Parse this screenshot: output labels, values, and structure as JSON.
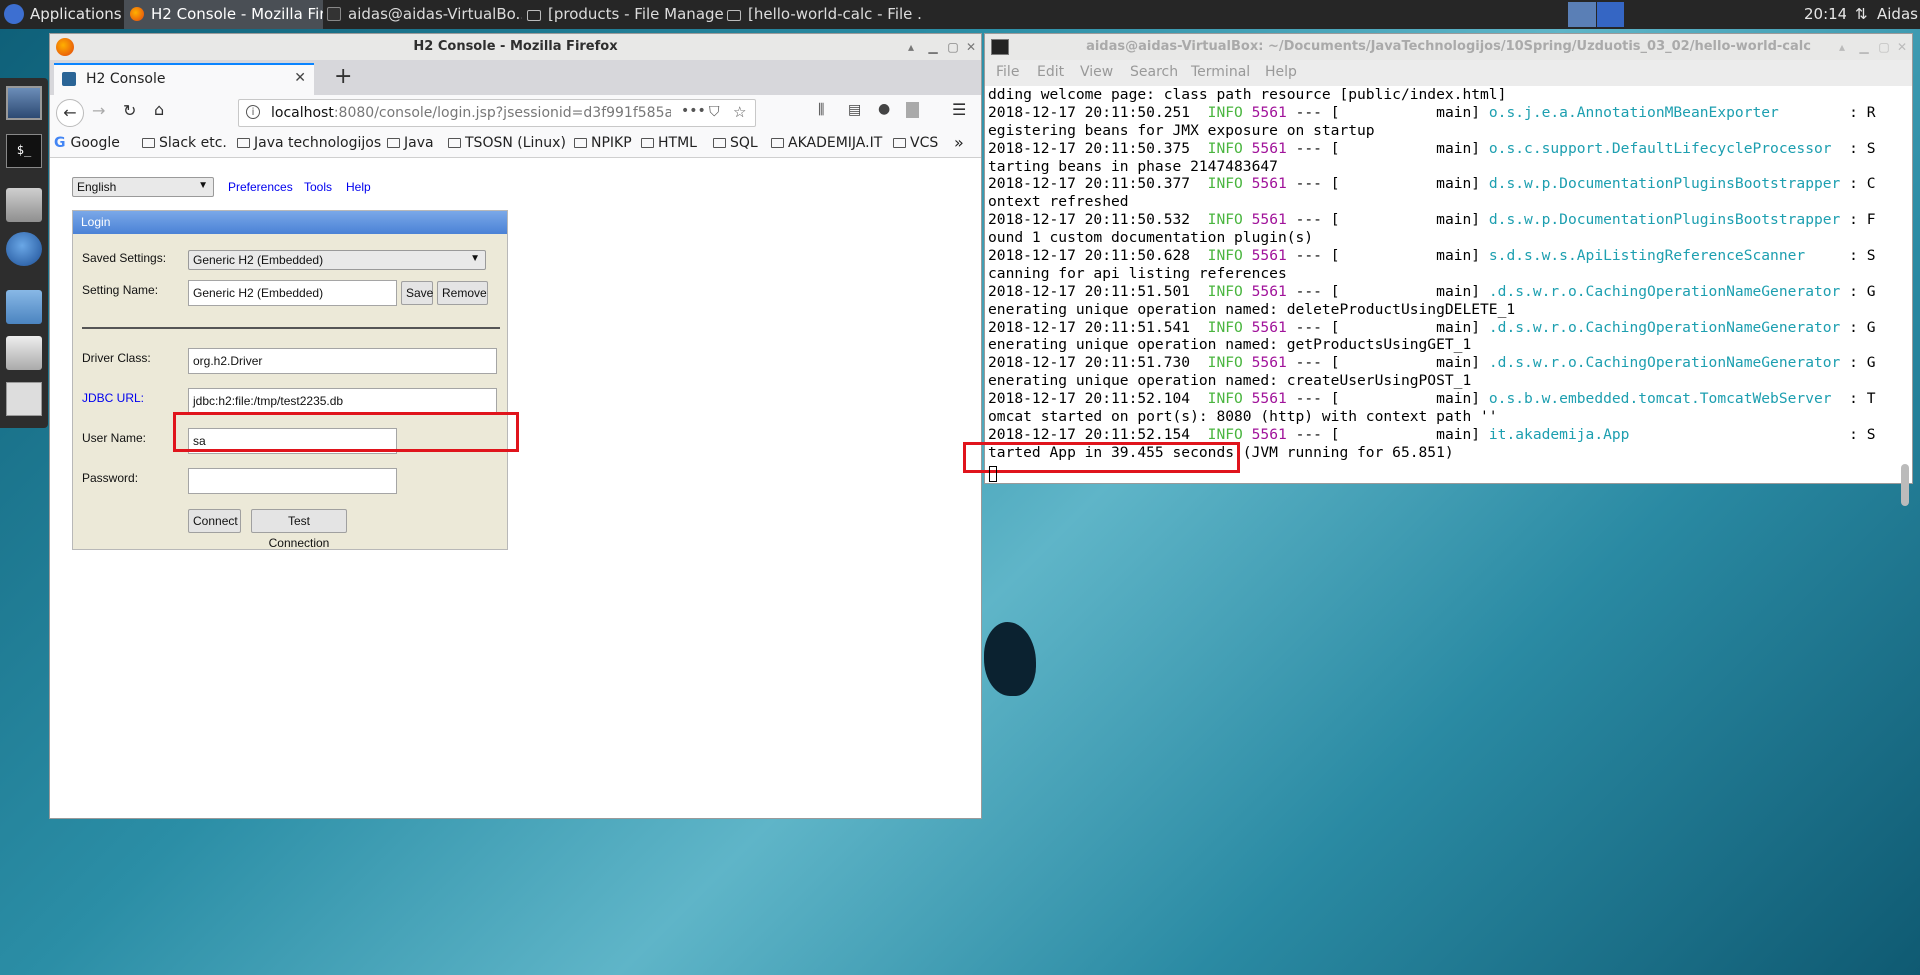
{
  "panel": {
    "applications": "Applications",
    "tasks": [
      {
        "label": "H2 Console - Mozilla Fir...",
        "active": true
      },
      {
        "label": "aidas@aidas-VirtualBo...",
        "active": false
      },
      {
        "label": "[products - File Manager]",
        "active": false
      },
      {
        "label": "[hello-world-calc - File ...",
        "active": false
      }
    ],
    "clock": "20:14",
    "user": "Aidas"
  },
  "firefox": {
    "window_title": "H2 Console - Mozilla Firefox",
    "tab_title": "H2 Console",
    "url_host": "localhost",
    "url_rest": ":8080/console/login.jsp?jsessionid=d3f991f585a",
    "bookmarks": [
      "Google",
      "Slack etc.",
      "Java technologijos",
      "Java",
      "TSOSN (Linux)",
      "NPIKP",
      "HTML",
      "SQL",
      "AKADEMIJA.IT",
      "VCS"
    ],
    "overflow": "»"
  },
  "h2": {
    "language": "English",
    "links": [
      "Preferences",
      "Tools",
      "Help"
    ],
    "login_header": "Login",
    "saved_settings_label": "Saved Settings:",
    "saved_settings_value": "Generic H2 (Embedded)",
    "setting_name_label": "Setting Name:",
    "setting_name_value": "Generic H2 (Embedded)",
    "save_button": "Save",
    "remove_button": "Remove",
    "driver_class_label": "Driver Class:",
    "driver_class_value": "org.h2.Driver",
    "jdbc_url_label": "JDBC URL:",
    "jdbc_url_value": "jdbc:h2:file:/tmp/test2235.db",
    "user_name_label": "User Name:",
    "user_name_value": "sa",
    "password_label": "Password:",
    "password_value": "",
    "connect_button": "Connect",
    "test_connection_button": "Test Connection"
  },
  "terminal": {
    "window_title": "aidas@aidas-VirtualBox: ~/Documents/JavaTechnologijos/10Spring/Uzduotis_03_02/hello-world-calc",
    "menu": [
      "File",
      "Edit",
      "View",
      "Search",
      "Terminal",
      "Help"
    ],
    "lines": [
      {
        "plain": "dding welcome page: class path resource [public/index.html]"
      },
      {
        "ts": "2018-12-17 20:11:50.251",
        "level": "INFO",
        "pid": "5561",
        "thread": "--- [           main]",
        "logger": "o.s.j.e.a.AnnotationMBeanExporter       ",
        "tail": " : R"
      },
      {
        "plain": "egistering beans for JMX exposure on startup"
      },
      {
        "ts": "2018-12-17 20:11:50.375",
        "level": "INFO",
        "pid": "5561",
        "thread": "--- [           main]",
        "logger": "o.s.c.support.DefaultLifecycleProcessor ",
        "tail": " : S"
      },
      {
        "plain": "tarting beans in phase 2147483647"
      },
      {
        "ts": "2018-12-17 20:11:50.377",
        "level": "INFO",
        "pid": "5561",
        "thread": "--- [           main]",
        "logger": "d.s.w.p.DocumentationPluginsBootstrapper",
        "tail": " : C"
      },
      {
        "plain": "ontext refreshed"
      },
      {
        "ts": "2018-12-17 20:11:50.532",
        "level": "INFO",
        "pid": "5561",
        "thread": "--- [           main]",
        "logger": "d.s.w.p.DocumentationPluginsBootstrapper",
        "tail": " : F"
      },
      {
        "plain": "ound 1 custom documentation plugin(s)"
      },
      {
        "ts": "2018-12-17 20:11:50.628",
        "level": "INFO",
        "pid": "5561",
        "thread": "--- [           main]",
        "logger": "s.d.s.w.s.ApiListingReferenceScanner    ",
        "tail": " : S"
      },
      {
        "plain": "canning for api listing references"
      },
      {
        "ts": "2018-12-17 20:11:51.501",
        "level": "INFO",
        "pid": "5561",
        "thread": "--- [           main]",
        "logger": ".d.s.w.r.o.CachingOperationNameGenerator",
        "tail": " : G"
      },
      {
        "plain": "enerating unique operation named: deleteProductUsingDELETE_1"
      },
      {
        "ts": "2018-12-17 20:11:51.541",
        "level": "INFO",
        "pid": "5561",
        "thread": "--- [           main]",
        "logger": ".d.s.w.r.o.CachingOperationNameGenerator",
        "tail": " : G"
      },
      {
        "plain": "enerating unique operation named: getProductsUsingGET_1"
      },
      {
        "ts": "2018-12-17 20:11:51.730",
        "level": "INFO",
        "pid": "5561",
        "thread": "--- [           main]",
        "logger": ".d.s.w.r.o.CachingOperationNameGenerator",
        "tail": " : G"
      },
      {
        "plain": "enerating unique operation named: createUserUsingPOST_1"
      },
      {
        "ts": "2018-12-17 20:11:52.104",
        "level": "INFO",
        "pid": "5561",
        "thread": "--- [           main]",
        "logger": "o.s.b.w.embedded.tomcat.TomcatWebServer ",
        "tail": " : T"
      },
      {
        "plain": "omcat started on port(s): 8080 (http) with context path ''"
      },
      {
        "ts": "2018-12-17 20:11:52.154",
        "level": "INFO",
        "pid": "5561",
        "thread": "--- [           main]",
        "logger": "it.akademija.App                        ",
        "tail": " : S"
      },
      {
        "plain": "tarted App in 39.455 seconds (JVM running for 65.851)"
      }
    ]
  }
}
